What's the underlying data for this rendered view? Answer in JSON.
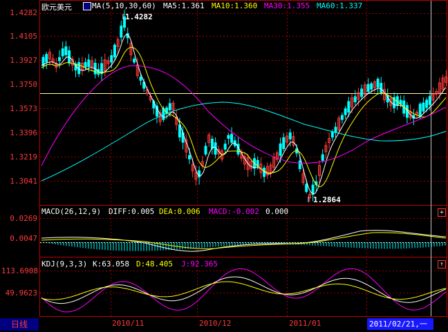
{
  "main_panel": {
    "symbol": "欧元美元",
    "ma_label": "MA(5,10,30,60)",
    "ma5": "MA5:1.361",
    "ma10": "MA10:1.360",
    "ma30": "MA30:1.355",
    "ma60": "MA60:1.337",
    "y_ticks": [
      "1.4282",
      "1.4105",
      "1.3927",
      "1.3750",
      "1.3573",
      "1.3396",
      "1.3219",
      "1.3041"
    ],
    "high_marker": "1.4282",
    "low_marker": "1.2864"
  },
  "macd_panel": {
    "title": "MACD(26,12,9)",
    "diff": "DIFF:0.005",
    "dea": "DEA:0.006",
    "macd": "MACD:-0.002",
    "zero": "0.000",
    "y_ticks": [
      "0.0269",
      "0.0047"
    ]
  },
  "kdj_panel": {
    "title": "KDJ(9,3,3)",
    "k": "K:63.058",
    "d": "D:48.405",
    "j": "J:92.365",
    "y_ticks": [
      "113.6908",
      "49.9623"
    ]
  },
  "x_axis": {
    "dates": [
      "2010/11",
      "2010/12",
      "2011/01"
    ]
  },
  "footer": {
    "tab_label": "日线",
    "cursor_date": "2011/02/21,一"
  },
  "colors": {
    "up": "#ff3b3b",
    "down": "#00ffff",
    "ma5": "#ffffff",
    "ma10": "#ffff00",
    "ma30": "#ff00ff",
    "ma60": "#00ffff",
    "grid": "#a00000"
  }
}
